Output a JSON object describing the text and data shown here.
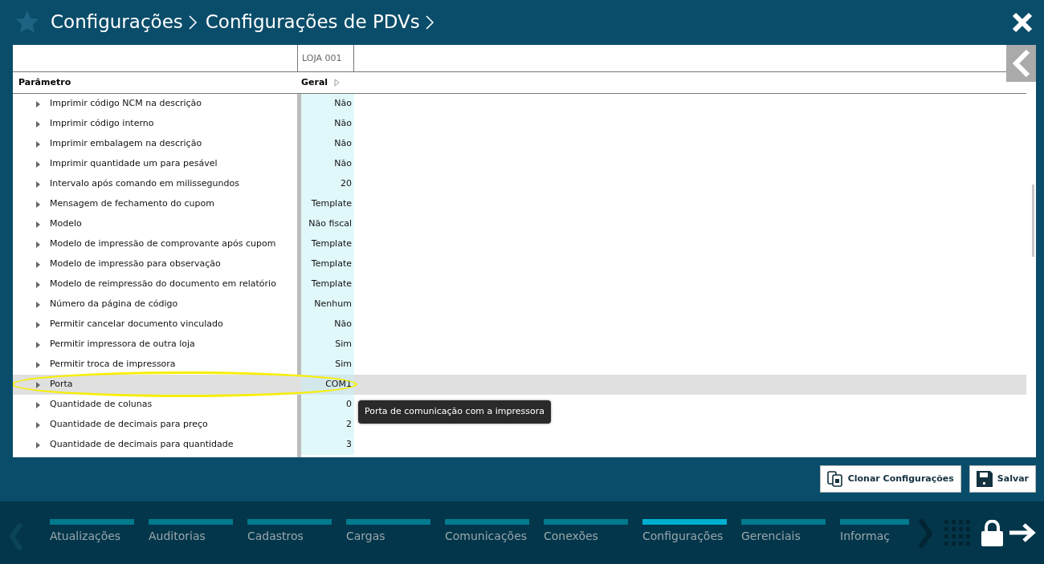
{
  "breadcrumb": [
    "Configurações",
    "Configurações de PDVs"
  ],
  "table": {
    "store_header": "LOJA 001",
    "columns": [
      "Parâmetro",
      "Geral"
    ],
    "rows": [
      {
        "label": "Imprimir código NCM na descrição",
        "value": "Não",
        "selected": false,
        "highlighted": false
      },
      {
        "label": "Imprimir código interno",
        "value": "Não",
        "selected": false,
        "highlighted": false
      },
      {
        "label": "Imprimir embalagem na descrição",
        "value": "Não",
        "selected": false,
        "highlighted": false
      },
      {
        "label": "Imprimir quantidade um para pesável",
        "value": "Não",
        "selected": false,
        "highlighted": false
      },
      {
        "label": "Intervalo após comando em milissegundos",
        "value": "20",
        "selected": false,
        "highlighted": false
      },
      {
        "label": "Mensagem de fechamento do cupom",
        "value": "Template",
        "selected": false,
        "highlighted": false
      },
      {
        "label": "Modelo",
        "value": "Não fiscal",
        "selected": false,
        "highlighted": false
      },
      {
        "label": "Modelo de impressão de comprovante após cupom",
        "value": "Template",
        "selected": false,
        "highlighted": false
      },
      {
        "label": "Modelo de impressão para observação",
        "value": "Template",
        "selected": false,
        "highlighted": false
      },
      {
        "label": "Modelo de reimpressão do documento em relatório",
        "value": "Template",
        "selected": false,
        "highlighted": false
      },
      {
        "label": "Número da página de código",
        "value": "Nenhum",
        "selected": false,
        "highlighted": false
      },
      {
        "label": "Permitir cancelar documento vinculado",
        "value": "Não",
        "selected": false,
        "highlighted": false
      },
      {
        "label": "Permitir impressora de outra loja",
        "value": "Sim",
        "selected": false,
        "highlighted": false
      },
      {
        "label": "Permitir troca de impressora",
        "value": "Sim",
        "selected": false,
        "highlighted": false
      },
      {
        "label": "Porta",
        "value": "COM1",
        "selected": true,
        "highlighted": true
      },
      {
        "label": "Quantidade de colunas",
        "value": "0",
        "selected": false,
        "highlighted": false
      },
      {
        "label": "Quantidade de decimais para preço",
        "value": "2",
        "selected": false,
        "highlighted": false
      },
      {
        "label": "Quantidade de decimais para quantidade",
        "value": "3",
        "selected": false,
        "highlighted": false
      }
    ]
  },
  "tooltip": "Porta de comunicação com a impressora",
  "buttons": [
    {
      "kind": "clone",
      "label": "Clonar Configurações"
    },
    {
      "kind": "save",
      "label": "Salvar"
    }
  ],
  "bottom_tabs": [
    {
      "label": "Atualizações",
      "selected": false
    },
    {
      "label": "Auditorias",
      "selected": false
    },
    {
      "label": "Cadastros",
      "selected": false
    },
    {
      "label": "Cargas",
      "selected": false
    },
    {
      "label": "Comunicações",
      "selected": false
    },
    {
      "label": "Conexões",
      "selected": false
    },
    {
      "label": "Configurações",
      "selected": true
    },
    {
      "label": "Gerenciais",
      "selected": false
    },
    {
      "label": "Informaç",
      "selected": false
    }
  ]
}
